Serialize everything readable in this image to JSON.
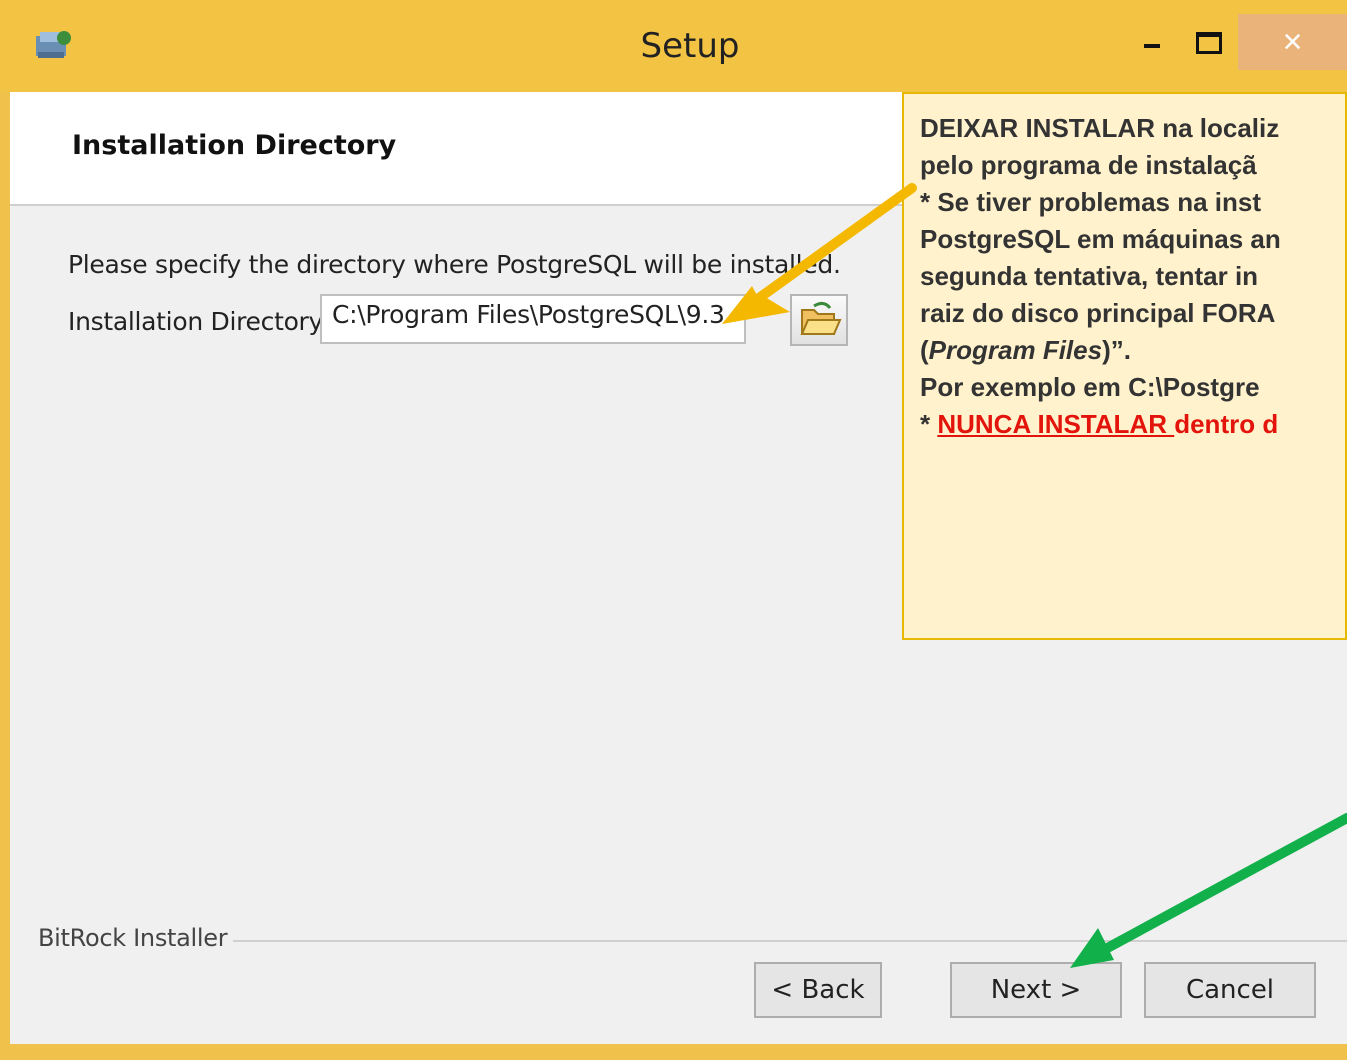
{
  "window": {
    "title": "Setup",
    "close_glyph": "×"
  },
  "header": {
    "title": "Installation Directory"
  },
  "main": {
    "prompt": "Please specify the directory where PostgreSQL will be installed.",
    "dir_label": "Installation Directory",
    "dir_value": "C:\\Program Files\\PostgreSQL\\9.3"
  },
  "footer": {
    "brand": "BitRock Installer",
    "back_label": "< Back",
    "next_label": "Next >",
    "cancel_label": "Cancel"
  },
  "annotation": {
    "line1": "DEIXAR INSTALAR na localiz",
    "line2": "pelo programa de instalaçã",
    "line3": "* Se tiver problemas na inst",
    "line4": "PostgreSQL em máquinas an",
    "line5": "segunda tentativa, tentar in",
    "line6": "raiz do disco principal FORA",
    "line7_open": "(",
    "line7_italic": "Program Files",
    "line7_close": ")”.",
    "line8": "Por exemplo em C:\\Postgre",
    "line9_prefix": "* ",
    "line9_red_underlined": "NUNCA INSTALAR ",
    "line9_red": "dentro d"
  },
  "colors": {
    "window_frame": "#f3c444",
    "callout_fill": "#fff2cc",
    "callout_border": "#e6b800",
    "arrow_yellow": "#f5b800",
    "arrow_green": "#12b04b",
    "warning_red": "#e3140c"
  },
  "icons": {
    "app": "installer-app-icon",
    "browse": "folder-open-icon",
    "minimize": "minimize-icon",
    "maximize": "maximize-icon",
    "close": "close-icon"
  }
}
